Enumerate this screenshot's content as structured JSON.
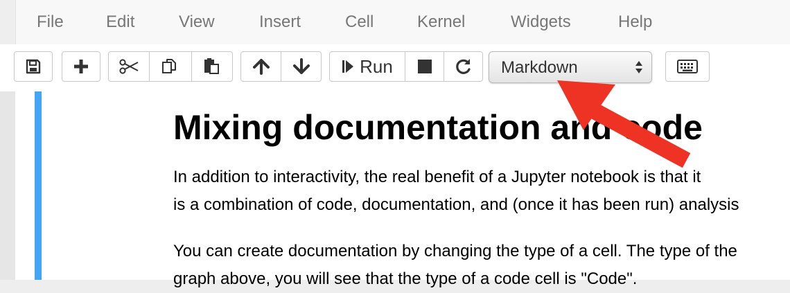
{
  "menubar": {
    "items": [
      "File",
      "Edit",
      "View",
      "Insert",
      "Cell",
      "Kernel",
      "Widgets",
      "Help"
    ]
  },
  "toolbar": {
    "run_label": "Run",
    "cell_type": {
      "selected": "Markdown"
    }
  },
  "icons": {
    "save": "floppy-disk-icon",
    "insert": "plus-icon",
    "cut": "scissors-icon",
    "copy": "copy-icon",
    "paste": "paste-icon",
    "move_up": "arrow-up-icon",
    "move_down": "arrow-down-icon",
    "run": "step-forward-icon",
    "stop": "stop-icon",
    "restart": "refresh-icon",
    "keyboard": "keyboard-icon"
  },
  "notebook": {
    "heading": "Mixing documentation and code",
    "lines": [
      "In addition to interactivity, the real benefit of a Jupyter notebook is that it",
      "is a combination of code, documentation, and (once it has been run) analysis",
      "You can create documentation by changing the type of a cell. The type of the",
      "graph above, you will see that the type of a code cell is \"Code\"."
    ]
  },
  "colors": {
    "cell_selection_bar": "#42a5f5",
    "annotation_arrow": "#ee3223"
  }
}
